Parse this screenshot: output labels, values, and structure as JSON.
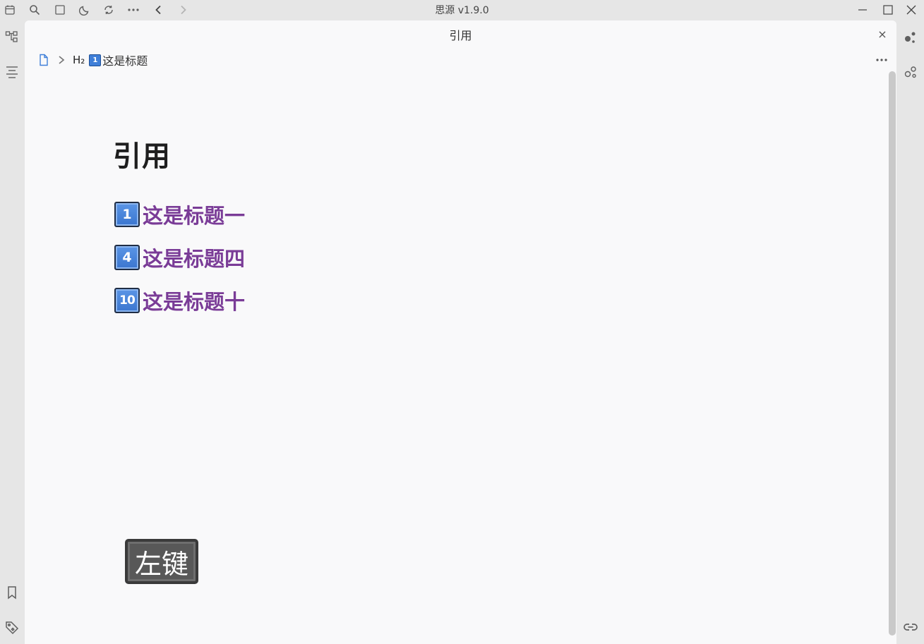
{
  "app": {
    "title": "思源 v1.9.0"
  },
  "titlebar": {
    "icons": [
      "calendar-icon",
      "search-icon",
      "square-icon",
      "moon-icon",
      "sync-icon",
      "more-icon",
      "back-icon",
      "forward-icon"
    ],
    "window_controls": [
      "minimize-icon",
      "maximize-icon",
      "close-icon"
    ]
  },
  "dock_left": {
    "icons": [
      "outline-tree-icon",
      "align-icon",
      "bookmark-icon",
      "tag-icon"
    ]
  },
  "dock_right": {
    "icons": [
      "graph-icon",
      "global-graph-icon",
      "backlink-icon"
    ]
  },
  "panel": {
    "title": "引用",
    "close_label": "×",
    "breadcrumb": {
      "heading_type": "H₂",
      "keycap": "1",
      "text": "这是标题"
    }
  },
  "document": {
    "title": "引用",
    "references": [
      {
        "keycap": "1",
        "text": "这是标题一"
      },
      {
        "keycap": "4",
        "text": "这是标题四"
      },
      {
        "keycap": "10",
        "text": "这是标题十"
      }
    ]
  },
  "key_overlay": {
    "label": "左键"
  },
  "colors": {
    "link": "#7a3c97",
    "keycap": "#3f7fd8",
    "background": "#f9f9fa"
  }
}
